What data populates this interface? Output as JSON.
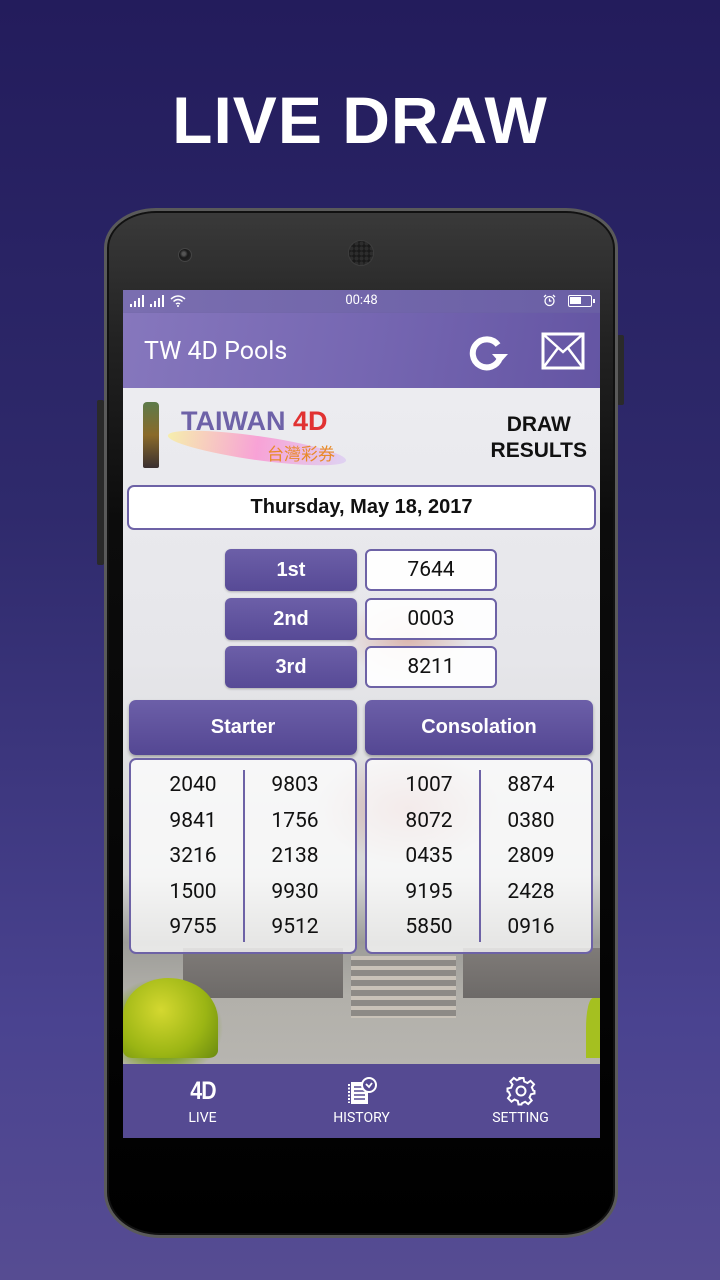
{
  "promo": {
    "headline": "LIVE DRAW"
  },
  "statusbar": {
    "time": "00:48",
    "icons": [
      "signal-icon",
      "signal-icon",
      "wifi-icon",
      "alarm-icon",
      "battery-icon"
    ]
  },
  "appbar": {
    "title": "TW 4D Pools",
    "actions": [
      "refresh-icon",
      "mail-icon"
    ]
  },
  "logo": {
    "text_main": "TAIWAN",
    "text_accent": "4D",
    "text_chinese": "台灣彩券",
    "accent_color": "#e13232",
    "main_color": "#6e62a8"
  },
  "header": {
    "draw_results_line1": "DRAW",
    "draw_results_line2": "RESULTS"
  },
  "draw": {
    "date": "Thursday, May 18, 2017",
    "prizes": [
      {
        "label": "1st",
        "number": "7644"
      },
      {
        "label": "2nd",
        "number": "0003"
      },
      {
        "label": "3rd",
        "number": "8211"
      }
    ],
    "starter": {
      "label": "Starter",
      "col1": [
        "2040",
        "9841",
        "3216",
        "1500",
        "9755"
      ],
      "col2": [
        "9803",
        "1756",
        "2138",
        "9930",
        "9512"
      ]
    },
    "consolation": {
      "label": "Consolation",
      "col1": [
        "1007",
        "8072",
        "0435",
        "9195",
        "5850"
      ],
      "col2": [
        "8874",
        "0380",
        "2809",
        "2428",
        "0916"
      ]
    }
  },
  "bottom_nav": [
    {
      "icon_text": "4D",
      "label": "LIVE",
      "icon": "4d-live-icon"
    },
    {
      "label": "HISTORY",
      "icon": "history-icon"
    },
    {
      "label": "SETTING",
      "icon": "gear-icon"
    }
  ],
  "colors": {
    "primary": "#6a5ea8",
    "nav": "#554a92",
    "background": "#2f2a6c"
  }
}
